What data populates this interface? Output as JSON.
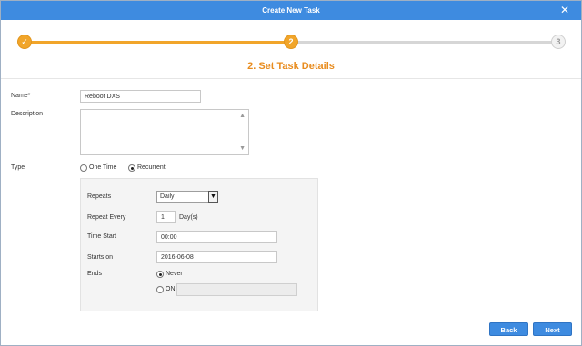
{
  "dialog": {
    "title": "Create New Task"
  },
  "steps": {
    "items": [
      {
        "label": "✓",
        "state": "done"
      },
      {
        "label": "2",
        "state": "current"
      },
      {
        "label": "3",
        "state": "pending"
      }
    ],
    "current_title": "2. Set Task Details"
  },
  "form": {
    "name": {
      "label": "Name*",
      "value": "Reboot DXS"
    },
    "description": {
      "label": "Description",
      "value": ""
    },
    "type": {
      "label": "Type",
      "options": [
        {
          "label": "One Time",
          "selected": false
        },
        {
          "label": "Recurrent",
          "selected": true
        }
      ]
    },
    "recurrence": {
      "repeats": {
        "label": "Repeats",
        "value": "Daily"
      },
      "repeat_every": {
        "label": "Repeat Every",
        "value": "1",
        "unit": "Day(s)"
      },
      "time_start": {
        "label": "Time Start",
        "value": "00:00"
      },
      "starts_on": {
        "label": "Starts on",
        "value": "2016-06-08"
      },
      "ends": {
        "label": "Ends",
        "options": [
          {
            "label": "Never",
            "selected": true
          },
          {
            "label": "ON",
            "selected": false,
            "value": ""
          }
        ]
      }
    }
  },
  "buttons": {
    "back": "Back",
    "next": "Next"
  },
  "colors": {
    "titlebar": "#3e8be0",
    "accent": "#f1a52a",
    "step_title": "#e88c1f",
    "button": "#3e8be0"
  }
}
